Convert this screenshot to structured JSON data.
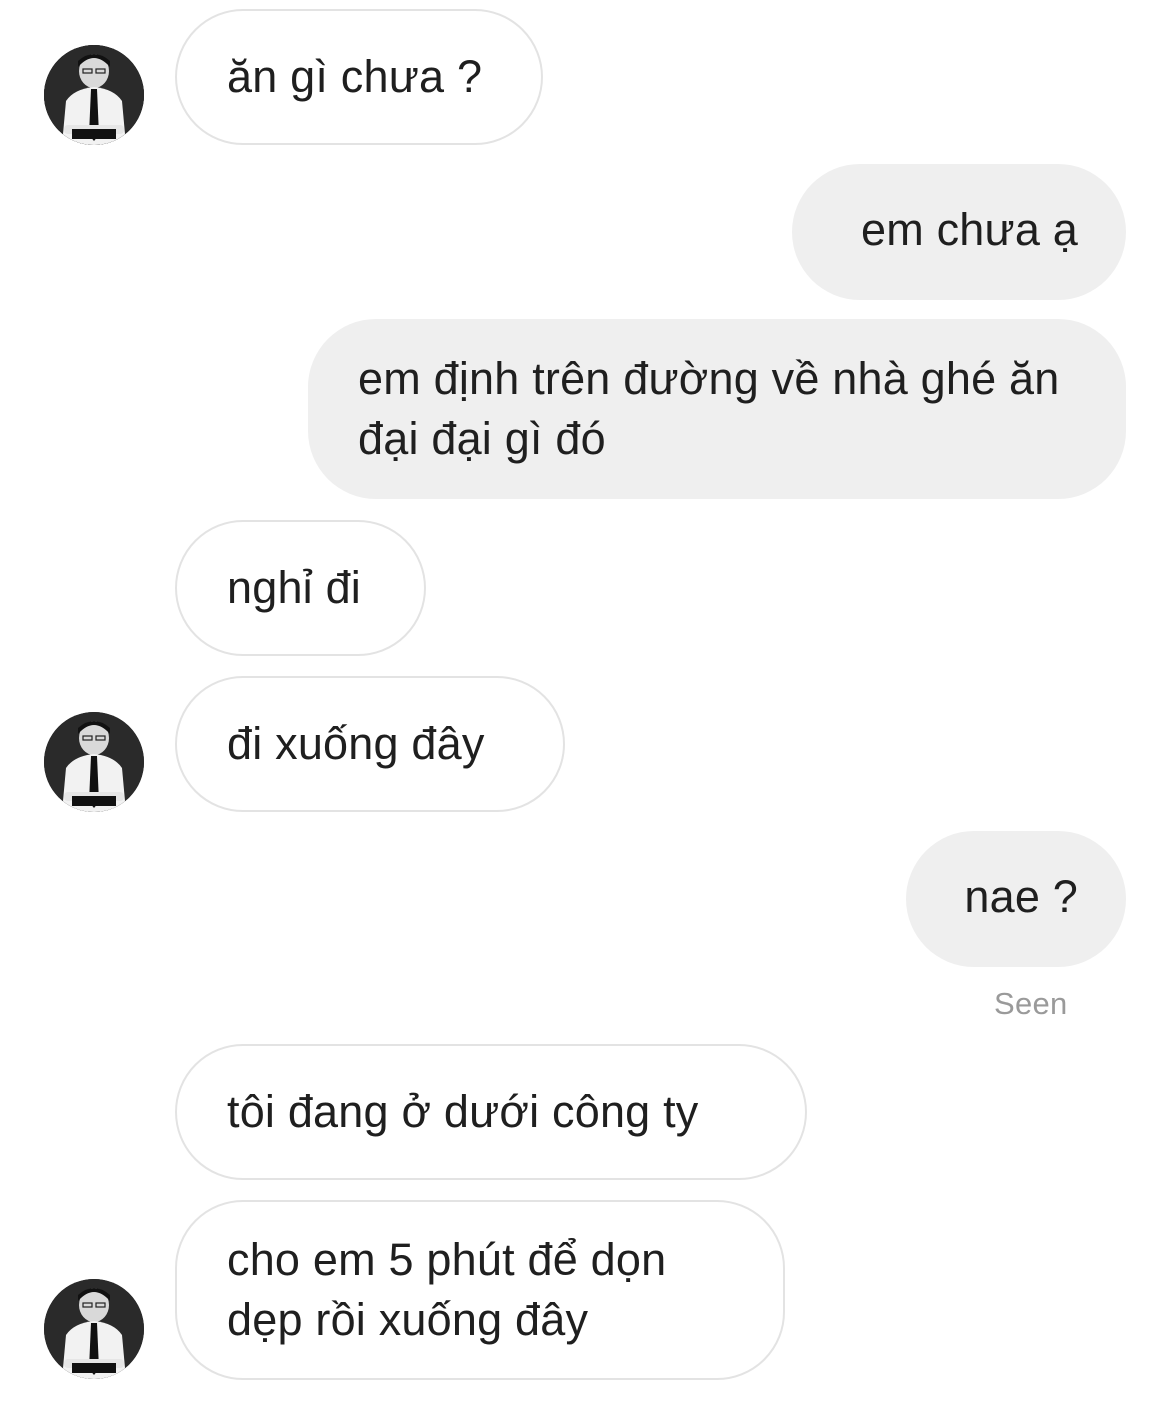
{
  "messages": [
    {
      "side": "in",
      "text": "ăn gì chưa ?"
    },
    {
      "side": "out",
      "text": "em chưa ạ"
    },
    {
      "side": "out",
      "text": "em định trên đường về nhà ghé ăn đại đại gì đó"
    },
    {
      "side": "in",
      "text": "nghỉ đi"
    },
    {
      "side": "in",
      "text": "đi xuống đây"
    },
    {
      "side": "out",
      "text": "nae ?"
    },
    {
      "side": "in",
      "text": "tôi đang ở dưới công ty"
    },
    {
      "side": "in",
      "text": "cho em 5 phút để dọn dẹp rồi xuống đây"
    }
  ],
  "status": {
    "seen_label": "Seen"
  },
  "avatar": {
    "icon": "contact-avatar-icon"
  },
  "colors": {
    "incoming_bubble_bg": "#ffffff",
    "incoming_bubble_border": "#e3e3e3",
    "outgoing_bubble_bg": "#efefef",
    "text": "#1f1f1f",
    "seen_text": "#9a9a9a"
  }
}
